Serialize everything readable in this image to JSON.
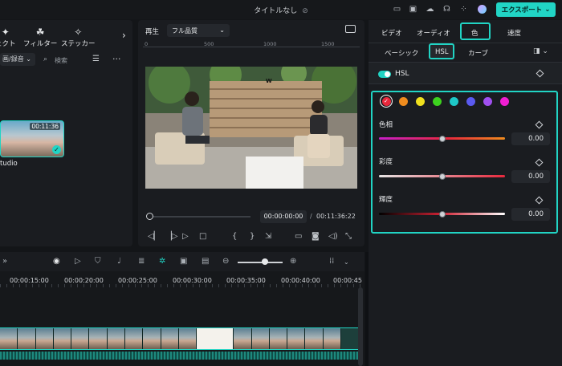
{
  "titlebar": {
    "title": "タイトルなし",
    "export_label": "エクスポート"
  },
  "media": {
    "tabs": [
      {
        "icon": "✦",
        "label": "ェクト"
      },
      {
        "icon": "☘",
        "label": "フィルター"
      },
      {
        "icon": "✧",
        "label": "ステッカー"
      }
    ],
    "folder": "画/録音",
    "search_placeholder": "検索",
    "thumb_duration": "00:11:36",
    "thumb_label": "tudio"
  },
  "player": {
    "play_label": "再生",
    "quality": "フル品質",
    "ruler": [
      "0",
      "500",
      "1000",
      "1500"
    ],
    "timecode_current": "00:00:00:00",
    "timecode_sep": "/",
    "timecode_total": "00:11:36:22"
  },
  "right": {
    "tabs": [
      "ビデオ",
      "オーディオ",
      "色",
      "速度"
    ],
    "subtabs": [
      "ベーシック",
      "HSL",
      "カーブ"
    ],
    "hsl_title": "HSL",
    "swatches": [
      "#e8283c",
      "#f08c1e",
      "#f0e01e",
      "#3cd21e",
      "#1ec8c8",
      "#5a5af0",
      "#a050f0",
      "#f01ed2"
    ],
    "params": [
      {
        "label": "色相",
        "value": "0.00",
        "level": 0.5
      },
      {
        "label": "彩度",
        "value": "0.00",
        "level": 0.5
      },
      {
        "label": "輝度",
        "value": "0.00",
        "level": 0.5
      }
    ]
  },
  "timeline": {
    "ruler": [
      "00:00:15:00",
      "00:00:20:00",
      "00:00:25:00",
      "00:00:30:00",
      "00:00:35:00",
      "00:00:40:00",
      "00:00:45"
    ]
  }
}
